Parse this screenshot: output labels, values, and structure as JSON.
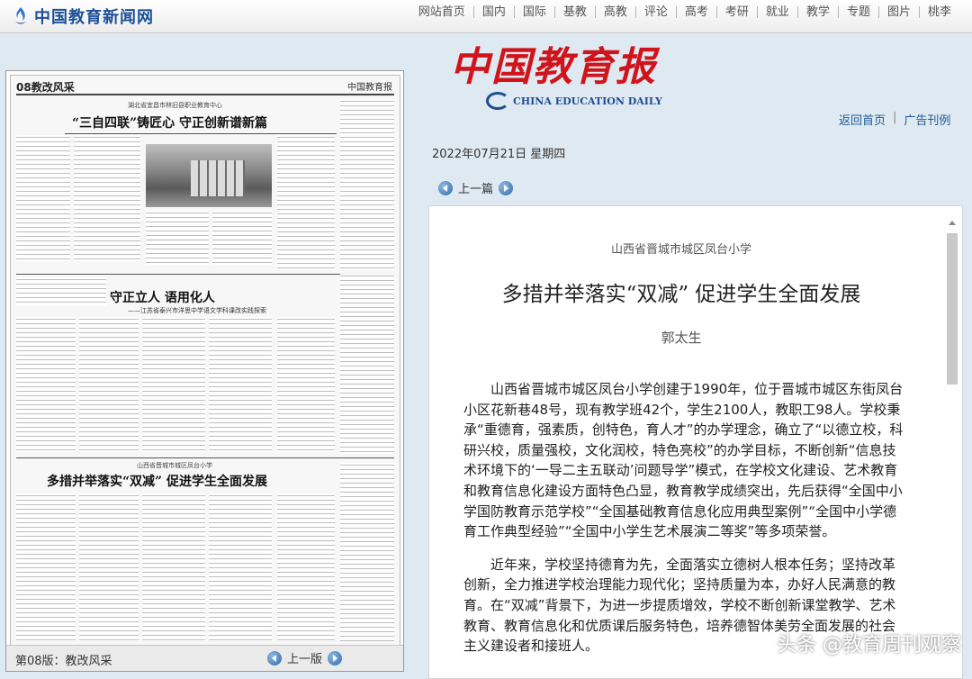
{
  "topbar": {
    "logo": "中国教育新闻网",
    "nav": [
      "网站首页",
      "国内",
      "国际",
      "基教",
      "高教",
      "评论",
      "高考",
      "考研",
      "就业",
      "教学",
      "专题",
      "图片",
      "桃李"
    ]
  },
  "masthead": {
    "title_cn": "中国教育报",
    "title_en": "CHINA EDUCATION DAILY",
    "links": [
      "返回首页",
      "广告刊例"
    ]
  },
  "date": "2022年07月21日  星期四",
  "pager": {
    "prev_label": "上一篇"
  },
  "paper_page": {
    "section": "08教改风采",
    "masthead": "中国教育报",
    "headline1_kicker": "湖北省宜昌市林旧县职业教育中心",
    "headline1": "“三自四联”铸匠心  守正创新谱新篇",
    "headline2": "守正立人  语用化人",
    "headline2_sub": "——江苏省泰兴市洋思中学语文学科课改实践探索",
    "headline3_kicker": "山西省晋城市城区凤台小学",
    "headline3": "多措并举落实“双减”  促进学生全面发展",
    "footer_label": "第08版：教改风采",
    "footer_prev": "上一版"
  },
  "article": {
    "org": "山西省晋城市城区凤台小学",
    "title": "多措并举落实“双减”   促进学生全面发展",
    "author": "郭太生",
    "paragraphs": [
      "山西省晋城市城区凤台小学创建于1990年，位于晋城市城区东街凤台小区花新巷48号，现有教学班42个，学生2100人，教职工98人。学校秉承“重德育，强素质，创特色，育人才”的办学理念，确立了“以德立校，科研兴校，质量强校，文化润校，特色亮校”的办学目标，不断创新“信息技术环境下的‘一导二主五联动’问题导学”模式，在学校文化建设、艺术教育和教育信息化建设方面特色凸显，教育教学成绩突出，先后获得“全国中小学国防教育示范学校”“全国基础教育信息化应用典型案例”“全国中小学德育工作典型经验”“全国中小学生艺术展演二等奖”等多项荣誉。",
      "近年来，学校坚持德育为先，全面落实立德树人根本任务；坚持改革创新，全力推进学校治理能力现代化；坚持质量为本，办好人民满意的教育。在“双减”背景下，为进一步提质增效，学校不断创新课堂教学、艺术教育、教育信息化和优质课后服务特色，培养德智体美劳全面发展的社会主义建设者和接班人。"
    ]
  },
  "watermark": "头条 @教育周刊观察"
}
